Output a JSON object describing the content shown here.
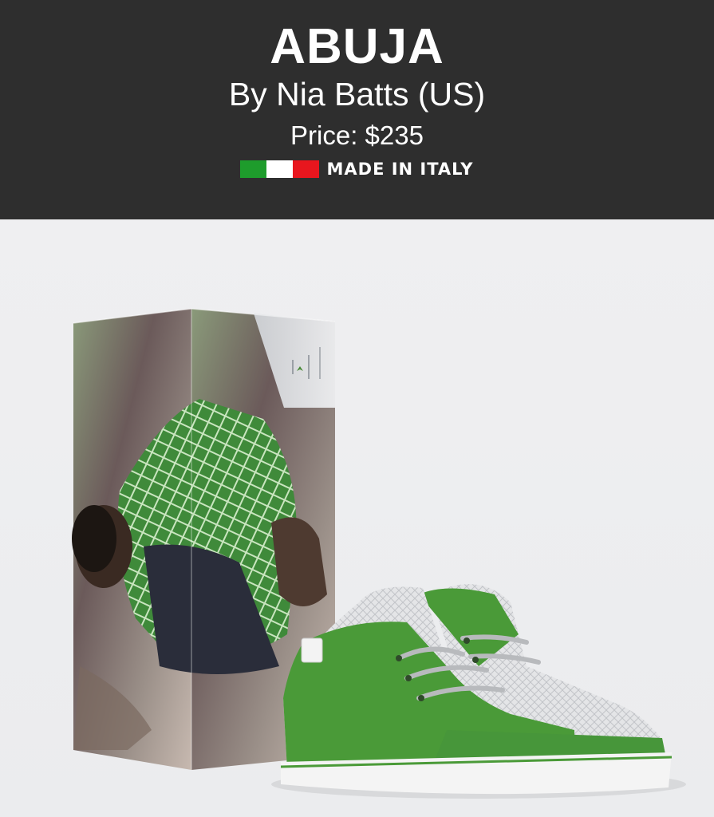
{
  "product": {
    "name": "ABUJA",
    "designer": "By Nia Batts (US)",
    "price": "Price: $235",
    "origin": "MADE IN ITALY"
  },
  "flag": {
    "colors": [
      "#1e9c2c",
      "#ffffff",
      "#e8161e"
    ],
    "icon": "italian-flag-icon"
  },
  "colors": {
    "header_bg": "#2e2e2e",
    "background": "#ecedef",
    "shoe_green": "#4a9a38",
    "mesh_white": "#e3e4e6"
  },
  "images": {
    "box": "shoebox-photo-print",
    "shoe": "green-white-chukka-sneaker"
  }
}
